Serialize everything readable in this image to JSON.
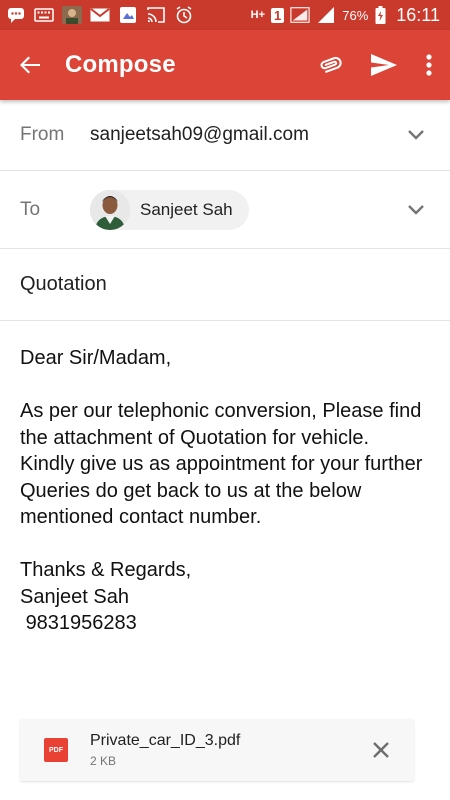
{
  "status_bar": {
    "battery": "76%",
    "time": "16:11",
    "network": "H+",
    "sim": "1",
    "icons": [
      "messaging-icon",
      "keyboard-icon",
      "app-thumbnail-icon",
      "gmail-icon",
      "photo-icon",
      "cast-icon",
      "alarm-icon",
      "signal-icon",
      "battery-icon"
    ]
  },
  "appbar": {
    "title": "Compose",
    "background": "#db4437",
    "icons": {
      "back": "arrow-back-icon",
      "attach": "paperclip-icon",
      "send": "send-icon",
      "more": "more-vert-icon"
    }
  },
  "from": {
    "label": "From",
    "value": "sanjeetsah09@gmail.com"
  },
  "to": {
    "label": "To",
    "recipient_name": "Sanjeet Sah"
  },
  "subject": "Quotation",
  "body": "Dear Sir/Madam,\n\nAs per our telephonic conversion, Please find the attachment of Quotation for vehicle.\nKindly give us as appointment for your further Queries do get back to us at the below mentioned contact number.\n\nThanks & Regards,\nSanjeet Sah\n 9831956283",
  "attachment": {
    "icon_label": "PDF",
    "filename": "Private_car_ID_3.pdf",
    "size": "2 KB"
  }
}
